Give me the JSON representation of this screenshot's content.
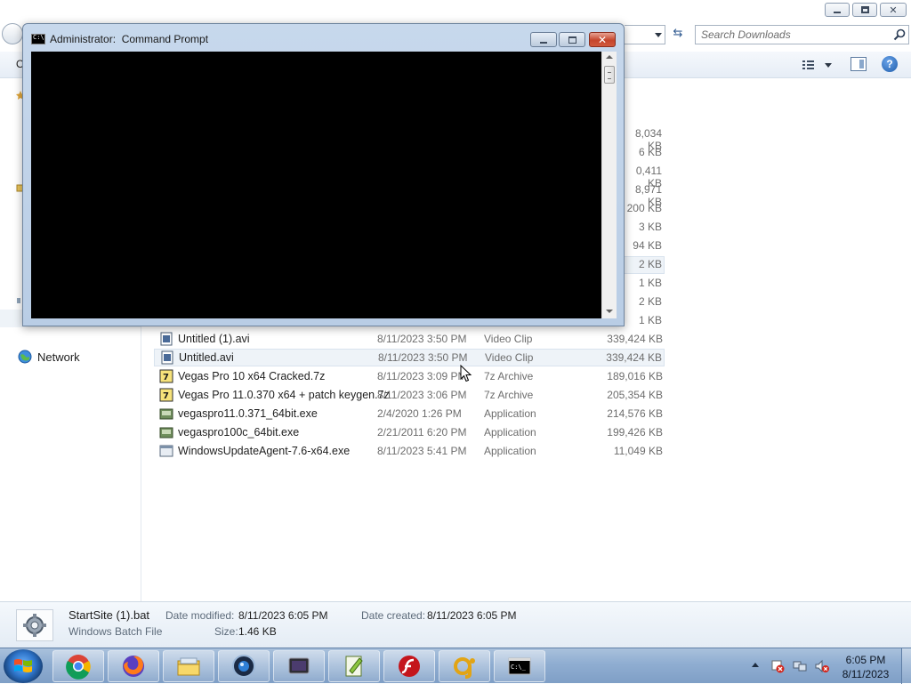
{
  "explorer": {
    "search_placeholder": "Search Downloads",
    "toolbar_left_fragment": "O",
    "help_label": "?",
    "nav": {
      "network_label": "Network"
    },
    "partial_sizes": [
      "8,034 KB",
      "6 KB",
      "0,411 KB",
      "8,971 KB",
      "200 KB",
      "3 KB",
      "94 KB",
      "2 KB",
      "1 KB",
      "2 KB",
      "1 KB"
    ],
    "files": [
      {
        "name": "Untitled (1).avi",
        "date": "8/11/2023 3:50 PM",
        "type": "Video Clip",
        "size": "339,424 KB",
        "icon": "video-file-icon"
      },
      {
        "name": "Untitled.avi",
        "date": "8/11/2023 3:50 PM",
        "type": "Video Clip",
        "size": "339,424 KB",
        "icon": "video-file-icon",
        "selected": true
      },
      {
        "name": "Vegas Pro 10 x64 Cracked.7z",
        "date": "8/11/2023 3:09 PM",
        "type": "7z Archive",
        "size": "189,016 KB",
        "icon": "archive-7z-icon"
      },
      {
        "name": "Vegas Pro 11.0.370 x64 + patch keygen.7z",
        "date": "8/11/2023 3:06 PM",
        "type": "7z Archive",
        "size": "205,354 KB",
        "icon": "archive-7z-icon"
      },
      {
        "name": "vegaspro11.0.371_64bit.exe",
        "date": "2/4/2020 1:26 PM",
        "type": "Application",
        "size": "214,576 KB",
        "icon": "installer-icon"
      },
      {
        "name": "vegaspro100c_64bit.exe",
        "date": "2/21/2011 6:20 PM",
        "type": "Application",
        "size": "199,426 KB",
        "icon": "installer-icon"
      },
      {
        "name": "WindowsUpdateAgent-7.6-x64.exe",
        "date": "8/11/2023 5:41 PM",
        "type": "Application",
        "size": "11,049 KB",
        "icon": "exe-icon"
      }
    ],
    "details": {
      "name": "StartSite (1).bat",
      "type": "Windows Batch File",
      "date_modified_label": "Date modified:",
      "date_modified": "8/11/2023 6:05 PM",
      "date_created_label": "Date created:",
      "date_created": "8/11/2023 6:05 PM",
      "size_label": "Size:",
      "size": "1.46 KB"
    }
  },
  "cmd": {
    "title": "Administrator:  Command Prompt",
    "icon_text": "C:\\"
  },
  "taskbar": {
    "pinned": [
      "chrome-icon",
      "firefox-icon",
      "file-explorer-icon",
      "media-center-icon",
      "terminal-app-icon",
      "notepad-plus-plus-icon",
      "flash-player-icon",
      "gom-player-icon",
      "command-prompt-icon"
    ],
    "clock_time": "6:05 PM",
    "clock_date": "8/11/2023"
  },
  "colors": {
    "selection": "#eef3f8",
    "taskbar": "#8fadd1",
    "cmd_frame": "#c7d8ec",
    "console": "#000000"
  }
}
